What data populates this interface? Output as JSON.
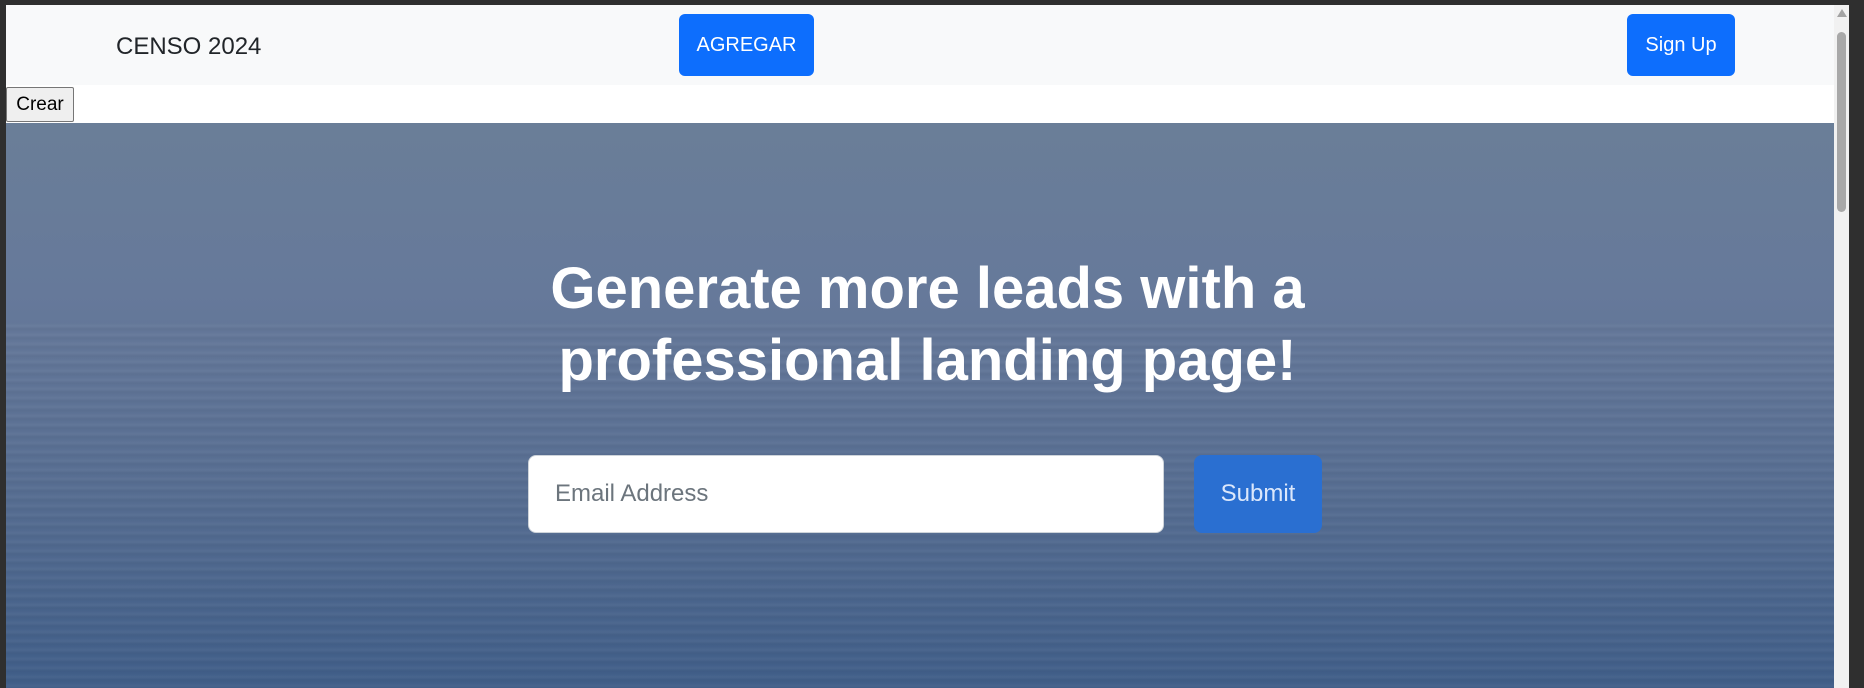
{
  "navbar": {
    "brand": "CENSO 2024",
    "agregar_label": "AGREGAR",
    "signup_label": "Sign Up"
  },
  "toolbar": {
    "crear_label": "Crear"
  },
  "hero": {
    "headline_line1": "Generate more leads with a",
    "headline_line2": "professional landing page!",
    "email_placeholder": "Email Address",
    "submit_label": "Submit"
  },
  "colors": {
    "primary": "#0d6efd",
    "navbar_bg": "#f8f9fa",
    "hero_top": "#6a7e98",
    "hero_bottom": "#3f5d88"
  },
  "icons": {
    "scroll_up": "scroll-up-arrow-icon"
  }
}
